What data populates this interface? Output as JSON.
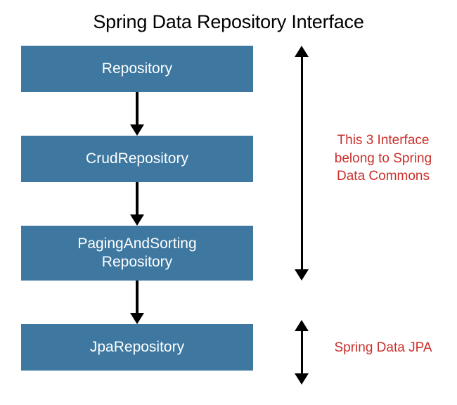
{
  "title": "Spring Data Repository Interface",
  "boxes": [
    {
      "label": "Repository"
    },
    {
      "label": "CrudRepository"
    },
    {
      "label": "PagingAndSorting\nRepository"
    },
    {
      "label": "JpaRepository"
    }
  ],
  "annotations": [
    {
      "text": "This 3 Interface belong to Spring Data Commons"
    },
    {
      "text": "Spring Data JPA"
    }
  ],
  "colors": {
    "box_bg": "#3e78a1",
    "box_text": "#ffffff",
    "annotation_text": "#c9302c",
    "arrow": "#000000"
  }
}
